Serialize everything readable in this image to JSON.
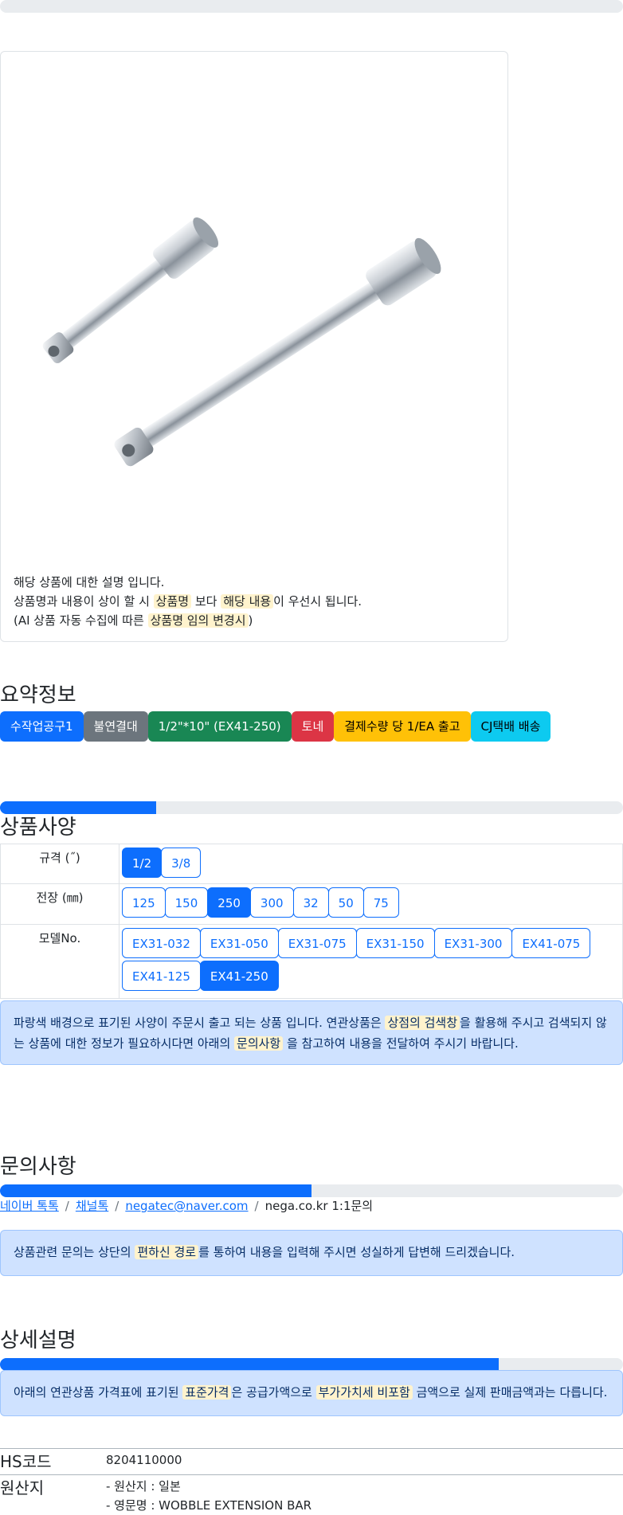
{
  "progress": {
    "top": 0.0,
    "spec": 0.25,
    "inquiry": 0.5,
    "detail": 0.8
  },
  "notice": {
    "line1": "해당 상품에 대한 설명 입니다.",
    "line2_a": "상품명과 내용이 상이 할 시 ",
    "line2_hl1": "상품명",
    "line2_b": " 보다 ",
    "line2_hl2": "해당 내용",
    "line2_c": "이 우선시 됩니다.",
    "line3_a": "(AI 상품 자동 수집에 따른 ",
    "line3_hl": "상품명 임의 변경시",
    "line3_b": ")"
  },
  "summary": {
    "title": "요약정보",
    "badges": [
      "수작업공구1",
      "불연결대",
      "1/2\"*10\" (EX41-250)",
      "토네",
      "결제수량 당 1/EA 출고",
      "CJ택배 배송"
    ]
  },
  "spec": {
    "title": "상품사양",
    "rows": [
      {
        "label": "규격 (˝)",
        "options": [
          "1/2",
          "3/8"
        ],
        "selected": "1/2"
      },
      {
        "label": "전장 (㎜)",
        "options": [
          "125",
          "150",
          "250",
          "300",
          "32",
          "50",
          "75"
        ],
        "selected": "250"
      },
      {
        "label": "모델No.",
        "options": [
          "EX31-032",
          "EX31-050",
          "EX31-075",
          "EX31-150",
          "EX31-300",
          "EX41-075",
          "EX41-125",
          "EX41-250"
        ],
        "selected": "EX41-250"
      }
    ],
    "alert": {
      "a": "파랑색 배경으로 표기된 사양이 주문시 출고 되는 상품 입니다. 연관상품은 ",
      "hl1": "상점의 검색창",
      "b": "을 활용해 주시고 검색되지 않는 상품에 대한 정보가 필요하시다면 아래의 ",
      "hl2": "문의사항",
      "c": " 을 참고하여 내용을 전달하여 주시기 바랍니다."
    }
  },
  "inquiry": {
    "title": "문의사항",
    "links": [
      "네이버 톡톡",
      "채널톡",
      "negatec@naver.com"
    ],
    "last": "nega.co.kr 1:1문의",
    "alert": {
      "a": "상품관련 문의는 상단의 ",
      "hl": "편하신 경로",
      "b": "를 통하여 내용을 입력해 주시면 성실하게 답변해 드리겠습니다."
    }
  },
  "detail": {
    "title": "상세설명",
    "alert": {
      "a": "아래의 연관상품 가격표에 표기된 ",
      "hl1": "표준가격",
      "b": "은 공급가액으로 ",
      "hl2": "부가가치세 비포함",
      "c": " 금액으로 실제 판매금액과는 다릅니다."
    },
    "hs_label": "HS코드",
    "hs_value": "8204110000",
    "origin_label": "원산지",
    "origin_line1": "- 원산지 : 일본",
    "origin_line2": "- 영문명 : WOBBLE EXTENSION BAR"
  }
}
